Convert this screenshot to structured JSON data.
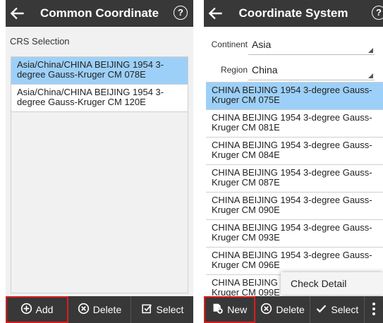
{
  "left": {
    "title": "Common Coordinate",
    "help": "?",
    "section_label": "CRS Selection",
    "items": [
      {
        "label": "Asia/China/CHINA BEIJING 1954 3-degree Gauss-Kruger CM 078E"
      },
      {
        "label": "Asia/China/CHINA BEIJING 1954 3-degree Gauss-Kruger CM 120E"
      }
    ],
    "buttons": {
      "add": "Add",
      "delete": "Delete",
      "select": "Select"
    }
  },
  "right": {
    "title": "Coordinate System",
    "help": "?",
    "continent_label": "Continent",
    "continent_value": "Asia",
    "region_label": "Region",
    "region_value": "China",
    "items": [
      {
        "label": "CHINA BEIJING 1954 3-degree Gauss-Kruger CM 075E"
      },
      {
        "label": "CHINA BEIJING 1954 3-degree Gauss-Kruger CM 081E"
      },
      {
        "label": "CHINA BEIJING 1954 3-degree Gauss-Kruger CM 084E"
      },
      {
        "label": "CHINA BEIJING 1954 3-degree Gauss-Kruger CM 087E"
      },
      {
        "label": "CHINA BEIJING 1954 3-degree Gauss-Kruger CM 090E"
      },
      {
        "label": "CHINA BEIJING 1954 3-degree Gauss-Kruger CM 093E"
      },
      {
        "label": "CHINA BEIJING 1954 3-degree Gauss-Kruger CM 096E"
      },
      {
        "label": "CHINA BEIJING 1954 3-degree Gauss-Kruger CM 099E"
      }
    ],
    "popup_item": "Check Detail",
    "buttons": {
      "new": "New",
      "delete": "Delete",
      "select": "Select"
    }
  },
  "colors": {
    "toolbar": "#383838",
    "selected_row": "#9dd0f8",
    "highlight": "#d81e1e"
  }
}
